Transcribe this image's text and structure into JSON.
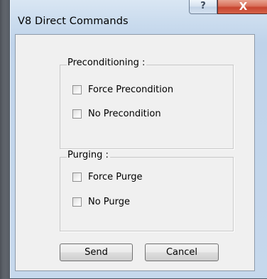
{
  "window": {
    "title": "V8 Direct Commands",
    "help_glyph": "?",
    "close_glyph": "X"
  },
  "preconditioning": {
    "legend": "Preconditioning :",
    "options": [
      {
        "label": "Force Precondition",
        "checked": false
      },
      {
        "label": "No Precondition",
        "checked": false
      }
    ]
  },
  "purging": {
    "legend": "Purging :",
    "options": [
      {
        "label": "Force Purge",
        "checked": false
      },
      {
        "label": "No Purge",
        "checked": false
      }
    ]
  },
  "buttons": {
    "send": "Send",
    "cancel": "Cancel"
  }
}
